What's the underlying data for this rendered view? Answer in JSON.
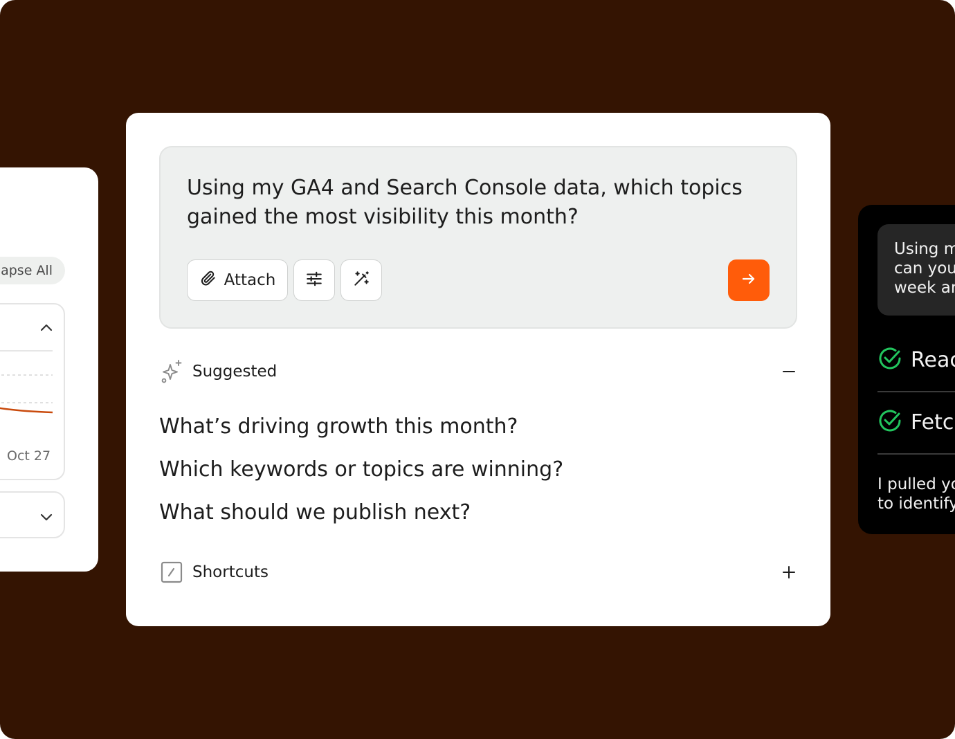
{
  "colors": {
    "background": "#341402",
    "accent": "#ff5c0a",
    "check": "#22c55e",
    "chart_line": "#c94a0c"
  },
  "left_panel": {
    "collapse_label": "lapse All",
    "chart_date_label": "Oct 27"
  },
  "composer": {
    "prompt": "Using my GA4 and Search Console data, which topics gained the most visibility this month?",
    "attach_label": "Attach",
    "attach_icon": "paperclip-icon",
    "settings_icon": "sliders-icon",
    "magic_icon": "magic-wand-icon",
    "send_icon": "arrow-right-icon"
  },
  "suggested": {
    "title": "Suggested",
    "icon": "sparkles-icon",
    "toggle_icon": "minus-icon",
    "items": [
      "What’s driving growth this month?",
      "Which keywords or topics are winning?",
      "What should we publish next?"
    ]
  },
  "shortcuts": {
    "title": "Shortcuts",
    "icon": "slash-square-icon",
    "toggle_icon": "plus-icon"
  },
  "right_panel": {
    "message": "Using m\ncan you\nweek ar",
    "steps": [
      {
        "label": "Reac",
        "icon": "check-circle-icon"
      },
      {
        "label": "Fetc",
        "icon": "check-circle-icon"
      }
    ],
    "summary": "I pulled yo\nto identify"
  }
}
